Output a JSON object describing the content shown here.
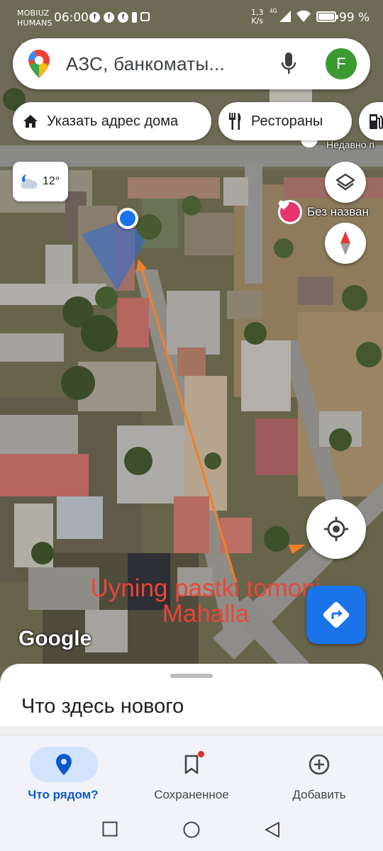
{
  "status_bar": {
    "carrier_line1": "MOBIUZ",
    "carrier_line2": "HUMANS",
    "time": "06:00",
    "net_speed_value": "1,3",
    "net_speed_unit": "K/s",
    "net_type": "4G",
    "battery": "99 %"
  },
  "search": {
    "query": "АЗС, банкоматы...",
    "account_initial": "F"
  },
  "chips": {
    "home": "Указать адрес дома",
    "restaurants": "Рестораны"
  },
  "map": {
    "weather_temp": "12°",
    "poi_unnamed": "Без назван",
    "poi_recent": "Недавно п",
    "annotation_line1": "Uyning pastki tomoni",
    "annotation_line2": "Mahalla",
    "watermark": "Google",
    "annotation_color": "#e8463a",
    "arrow_color": "#f0802a"
  },
  "sheet": {
    "title": "Что здесь нового"
  },
  "bottom_nav": {
    "explore": "Что рядом?",
    "saved": "Сохраненное",
    "contribute": "Добавить"
  },
  "colors": {
    "accent": "#1a73e8",
    "active_nav": "#0b57d0",
    "avatar": "#3c9a30"
  }
}
